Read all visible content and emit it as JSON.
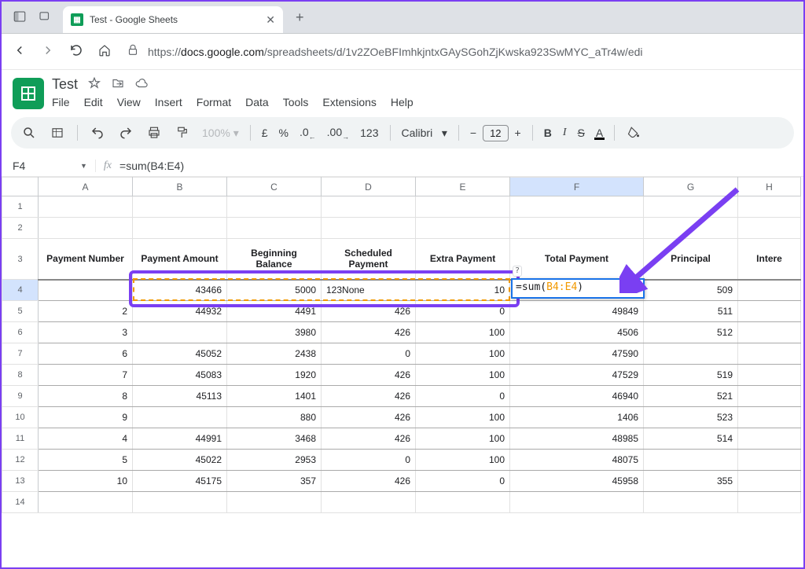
{
  "browser": {
    "tab_title": "Test - Google Sheets",
    "url_host": "docs.google.com",
    "url_prefix": "https://",
    "url_path": "/spreadsheets/d/1v2ZOeBFImhkjntxGAySGohZjKwska923SwMYC_aTr4w/edi"
  },
  "doc": {
    "title": "Test",
    "menus": [
      "File",
      "Edit",
      "View",
      "Insert",
      "Format",
      "Data",
      "Tools",
      "Extensions",
      "Help"
    ]
  },
  "toolbar": {
    "zoom": "100%",
    "currency": "£",
    "percent": "%",
    "dec_dec": ".0",
    "dec_inc": ".00",
    "numfmt": "123",
    "font": "Calibri",
    "minus": "−",
    "font_size": "12",
    "plus": "+",
    "bold": "B",
    "italic": "I",
    "strike": "S",
    "font_color": "A"
  },
  "formula": {
    "cell_ref": "F4",
    "value": "=sum(B4:E4)"
  },
  "editor": {
    "prefix": "=sum(",
    "range": "B4:E4",
    "suffix": ")"
  },
  "columns": [
    "A",
    "B",
    "C",
    "D",
    "E",
    "F",
    "G",
    "H"
  ],
  "row_numbers": [
    "1",
    "2",
    "3",
    "4",
    "5",
    "6",
    "7",
    "8",
    "9",
    "10",
    "11",
    "12",
    "13",
    "14"
  ],
  "headers": {
    "A": "Payment Number",
    "B": "Payment Amount",
    "C": "Beginning Balance",
    "D": "Scheduled Payment",
    "E": "Extra Payment",
    "F": "Total Payment",
    "G": "Principal",
    "H": "Intere"
  },
  "rows": [
    {
      "A": "",
      "B": "43466",
      "C": "5000",
      "D": "123None",
      "E": "10",
      "F": "",
      "G": "509"
    },
    {
      "A": "2",
      "B": "44932",
      "C": "4491",
      "D": "426",
      "E": "0",
      "F": "49849",
      "G": "511"
    },
    {
      "A": "3",
      "B": "",
      "C": "3980",
      "D": "426",
      "E": "100",
      "F": "4506",
      "G": "512"
    },
    {
      "A": "6",
      "B": "45052",
      "C": "2438",
      "D": "0",
      "E": "100",
      "F": "47590",
      "G": ""
    },
    {
      "A": "7",
      "B": "45083",
      "C": "1920",
      "D": "426",
      "E": "100",
      "F": "47529",
      "G": "519"
    },
    {
      "A": "8",
      "B": "45113",
      "C": "1401",
      "D": "426",
      "E": "0",
      "F": "46940",
      "G": "521"
    },
    {
      "A": "9",
      "B": "",
      "C": "880",
      "D": "426",
      "E": "100",
      "F": "1406",
      "G": "523"
    },
    {
      "A": "4",
      "B": "44991",
      "C": "3468",
      "D": "426",
      "E": "100",
      "F": "48985",
      "G": "514"
    },
    {
      "A": "5",
      "B": "45022",
      "C": "2953",
      "D": "0",
      "E": "100",
      "F": "48075",
      "G": ""
    },
    {
      "A": "10",
      "B": "45175",
      "C": "357",
      "D": "426",
      "E": "0",
      "F": "45958",
      "G": "355"
    }
  ]
}
